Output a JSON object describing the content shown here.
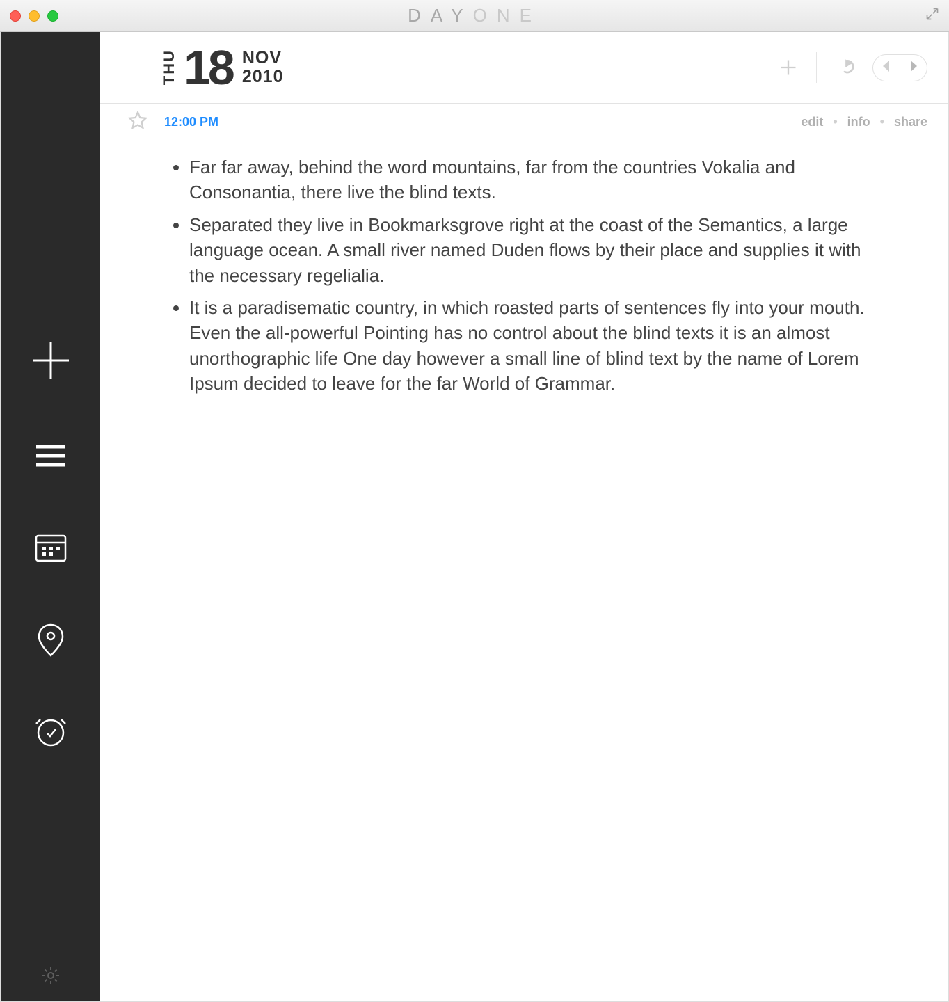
{
  "app_title_part1": "DAY",
  "app_title_part2": "ONE",
  "date": {
    "dow": "THU",
    "day": "18",
    "month": "NOV",
    "year": "2010"
  },
  "entry_time": "12:00 PM",
  "meta_actions": {
    "edit": "edit",
    "info": "info",
    "share": "share"
  },
  "bullets": [
    "Far far away, behind the word mountains, far from the countries Vokalia and Consonantia, there live the blind texts.",
    "Separated they live in Bookmarksgrove right at the coast of the Semantics, a large language ocean. A small river named Duden flows by their place and supplies it with the necessary regelialia.",
    "It is a paradisematic country, in which roasted parts of sentences fly into your mouth. Even the all-powerful Pointing has no control about the blind texts it is an almost unorthographic life One day however a small line of blind text by the name of Lorem Ipsum decided to leave for the far World of Grammar."
  ]
}
